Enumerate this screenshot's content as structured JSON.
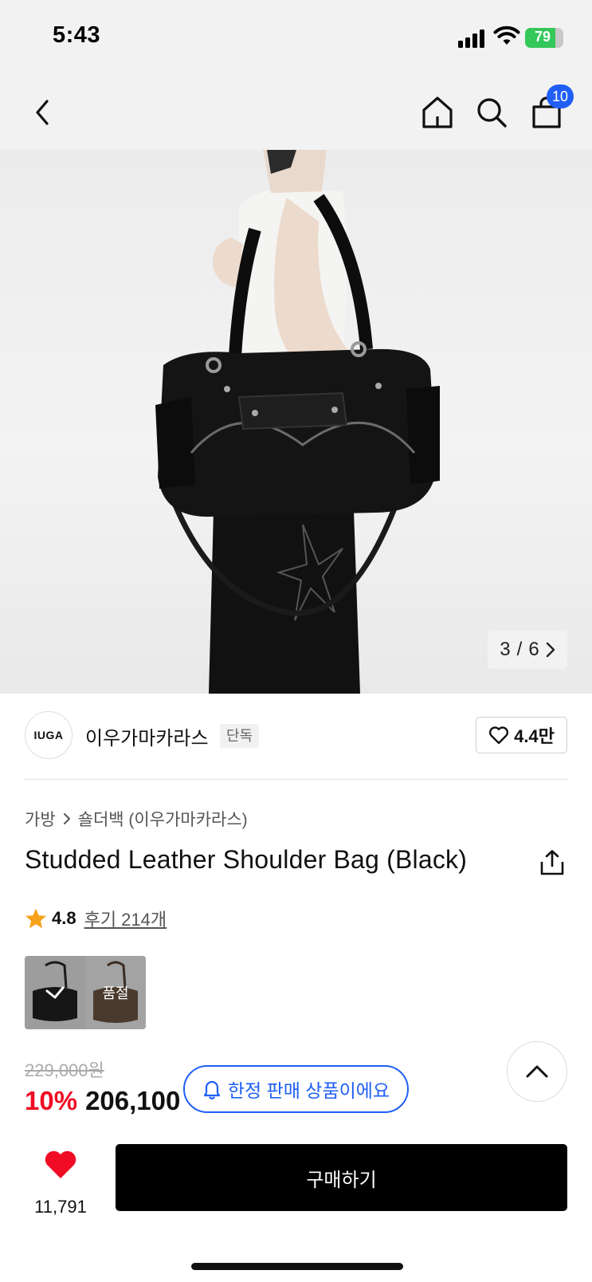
{
  "status_bar": {
    "time": "5:43",
    "battery": "79",
    "battery_level": 0.79
  },
  "nav": {
    "back_icon": "chevron-left-icon",
    "home_icon": "home-icon",
    "search_icon": "search-icon",
    "cart_icon": "shopping-bag-icon",
    "cart_count": "10"
  },
  "gallery": {
    "current": "3",
    "separator": "/",
    "total": "6"
  },
  "brand": {
    "logo_text": "IUGA",
    "name": "이우가마카라스",
    "tag": "단독",
    "likes": "4.4만"
  },
  "breadcrumb": {
    "category": "가방",
    "subcategory": "숄더백 (이우가마카라스)"
  },
  "product": {
    "title": "Studded Leather Shoulder Bag (Black)",
    "rating": "4.8",
    "reviews": "후기 214개",
    "soldout_label": "품절",
    "original_price": "229,000원",
    "discount": "10%",
    "sale_price": "206,100"
  },
  "notice": {
    "limited_label": "한정 판매 상품이에요"
  },
  "bottom": {
    "wish_count": "11,791",
    "buy_label": "구매하기"
  },
  "colors": {
    "accent_blue": "#1f5ff5",
    "discount_red": "#f00c24",
    "star": "#f7a21b",
    "heart": "#f00c24"
  }
}
